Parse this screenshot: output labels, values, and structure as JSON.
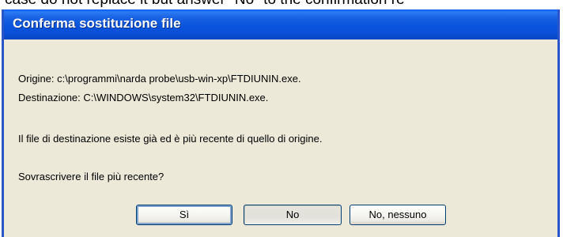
{
  "background_text": "case do not replace it but answer \"No\" to the confirmation re",
  "dialog": {
    "title": "Conferma sostituzione file",
    "origin": "Origine: c:\\programmi\\narda probe\\usb-win-xp\\FTDIUNIN.exe.",
    "destination": "Destinazione: C:\\WINDOWS\\system32\\FTDIUNIN.exe.",
    "message": "Il file di destinazione esiste già ed è più recente di quello di origine.",
    "question": "Sovrascrivere il file più recente?",
    "buttons": {
      "yes": "Sì",
      "no": "No",
      "no_to_all": "No, nessuno"
    }
  },
  "colors": {
    "titlebar": "#0a55de",
    "dialog_bg": "#ece9d8",
    "border": "#2a55c8"
  }
}
